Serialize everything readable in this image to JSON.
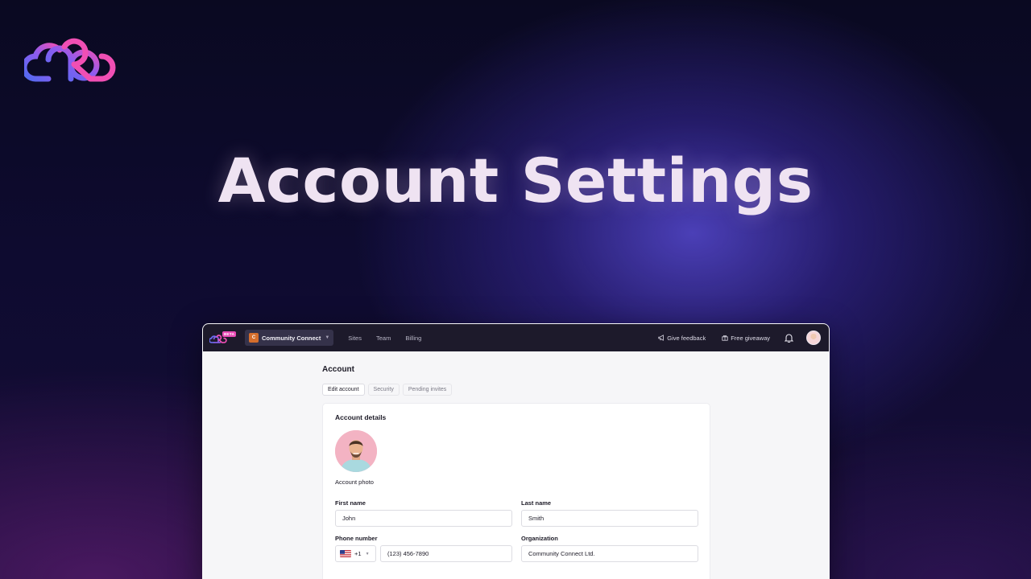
{
  "hero": {
    "title": "Account Settings"
  },
  "topbar": {
    "beta_badge": "BETA",
    "workspace": {
      "initial": "C",
      "name": "Community Connect"
    },
    "nav": [
      "Sites",
      "Team",
      "Billing"
    ],
    "feedback_label": "Give feedback",
    "giveaway_label": "Free giveaway"
  },
  "page": {
    "heading": "Account",
    "tabs": [
      "Edit account",
      "Security",
      "Pending invites"
    ],
    "active_tab": "Edit account"
  },
  "card": {
    "title": "Account details",
    "photo_label": "Account photo",
    "fields": {
      "first_name": {
        "label": "First name",
        "value": "John"
      },
      "last_name": {
        "label": "Last name",
        "value": "Smith"
      },
      "phone": {
        "label": "Phone number",
        "country_code": "+1",
        "value": "(123) 456-7890"
      },
      "organization": {
        "label": "Organization",
        "value": "Community Connect Ltd."
      }
    }
  },
  "colors": {
    "brand_pink": "#e84bb5",
    "brand_blue": "#4f6bf0",
    "topbar_bg": "#1d1a2b",
    "workspace_icon": "#d56e2c"
  }
}
